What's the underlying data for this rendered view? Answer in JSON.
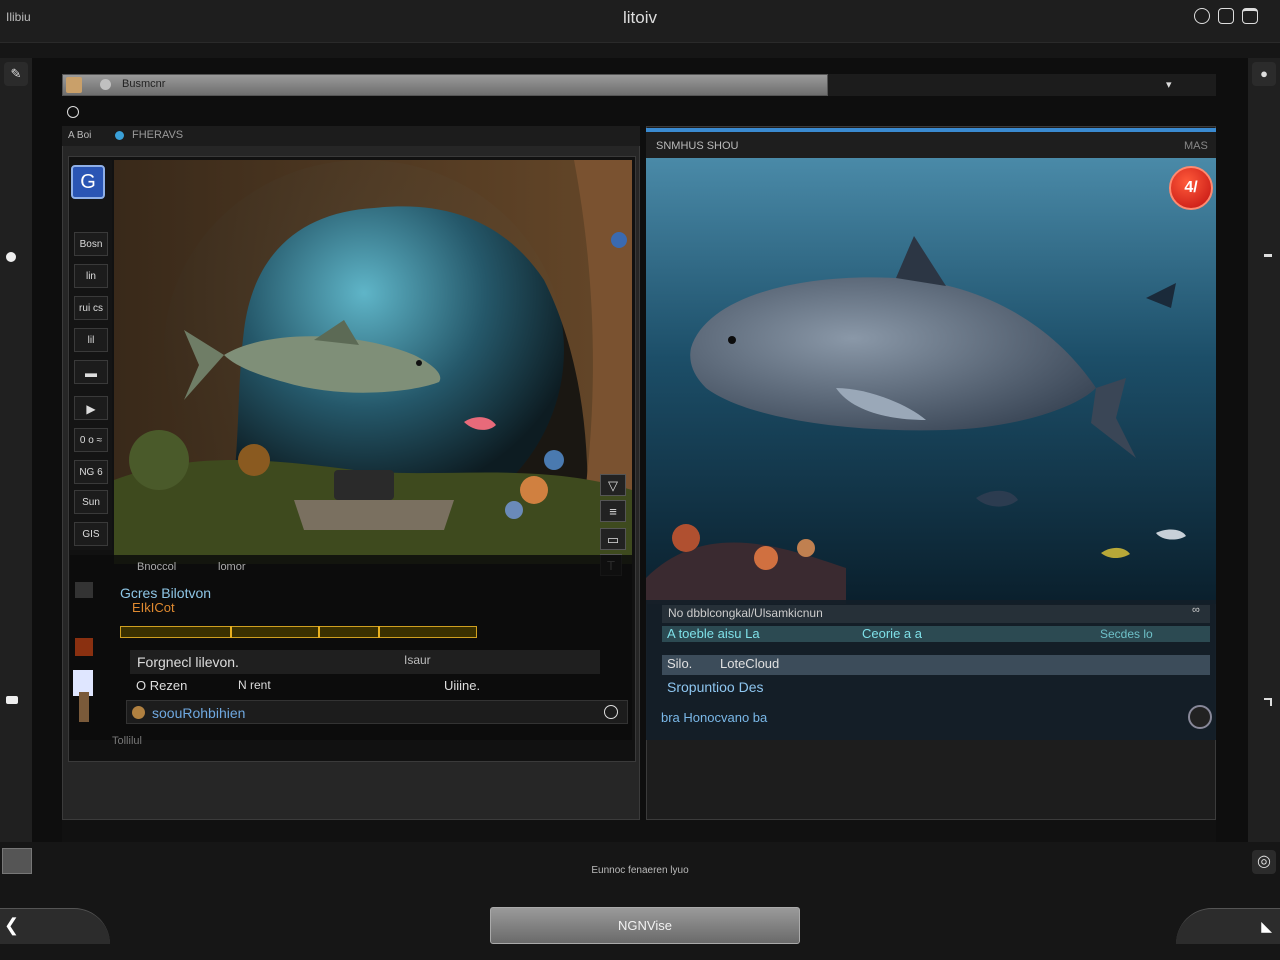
{
  "titlebar": {
    "app_name": "Ilibiu",
    "title": "litoiv",
    "icons": [
      "refresh-icon",
      "share-icon",
      "window-icon"
    ]
  },
  "toolbar": {
    "address": "Busmcnr"
  },
  "left_panel": {
    "header_left": "A Boi",
    "header_right": "FHERAVS",
    "tools": [
      "Bosn",
      "lin",
      "rui cs",
      "lil",
      "0 o ≈",
      "NG 6",
      "Sun",
      "GIS"
    ],
    "hud": {
      "top_a": "Bnoccol",
      "top_b": "lomor",
      "game_title": "Gcres Bilotvon",
      "game_sub": "EIkICot",
      "progress": 0.0,
      "row_a_left": "Forgnecl lilevon.",
      "row_a_mid": "Isaur",
      "row_b_left": "O Rezen",
      "row_b_mid": "N rent",
      "row_b_right": "Uiiine.",
      "row_c_text": "soouRohbihien",
      "footer": "Tollilul"
    }
  },
  "right_panel": {
    "title": "SNMHUS SHOU",
    "right_label": "MAS",
    "record_label": "4/",
    "info": {
      "line1": "No dbblcongkal/Ulsamkicnun",
      "line2a": "A toeble",
      "line2a_tail": "aisu La",
      "line2b": "Ceorie a a",
      "line2c": "Secdes lo",
      "line3a": "Silo.",
      "line3b": "LoteCloud",
      "line4": "Sropuntioo Des",
      "line5": "bra Honocvano ba"
    }
  },
  "status_text": "Eunnoc fenaeren lyuo",
  "buttons": {
    "main": "NGNVise"
  },
  "colors": {
    "accent_blue": "#3a8ad0",
    "record_red": "#d41818",
    "progress_gold": "#e0a020"
  }
}
